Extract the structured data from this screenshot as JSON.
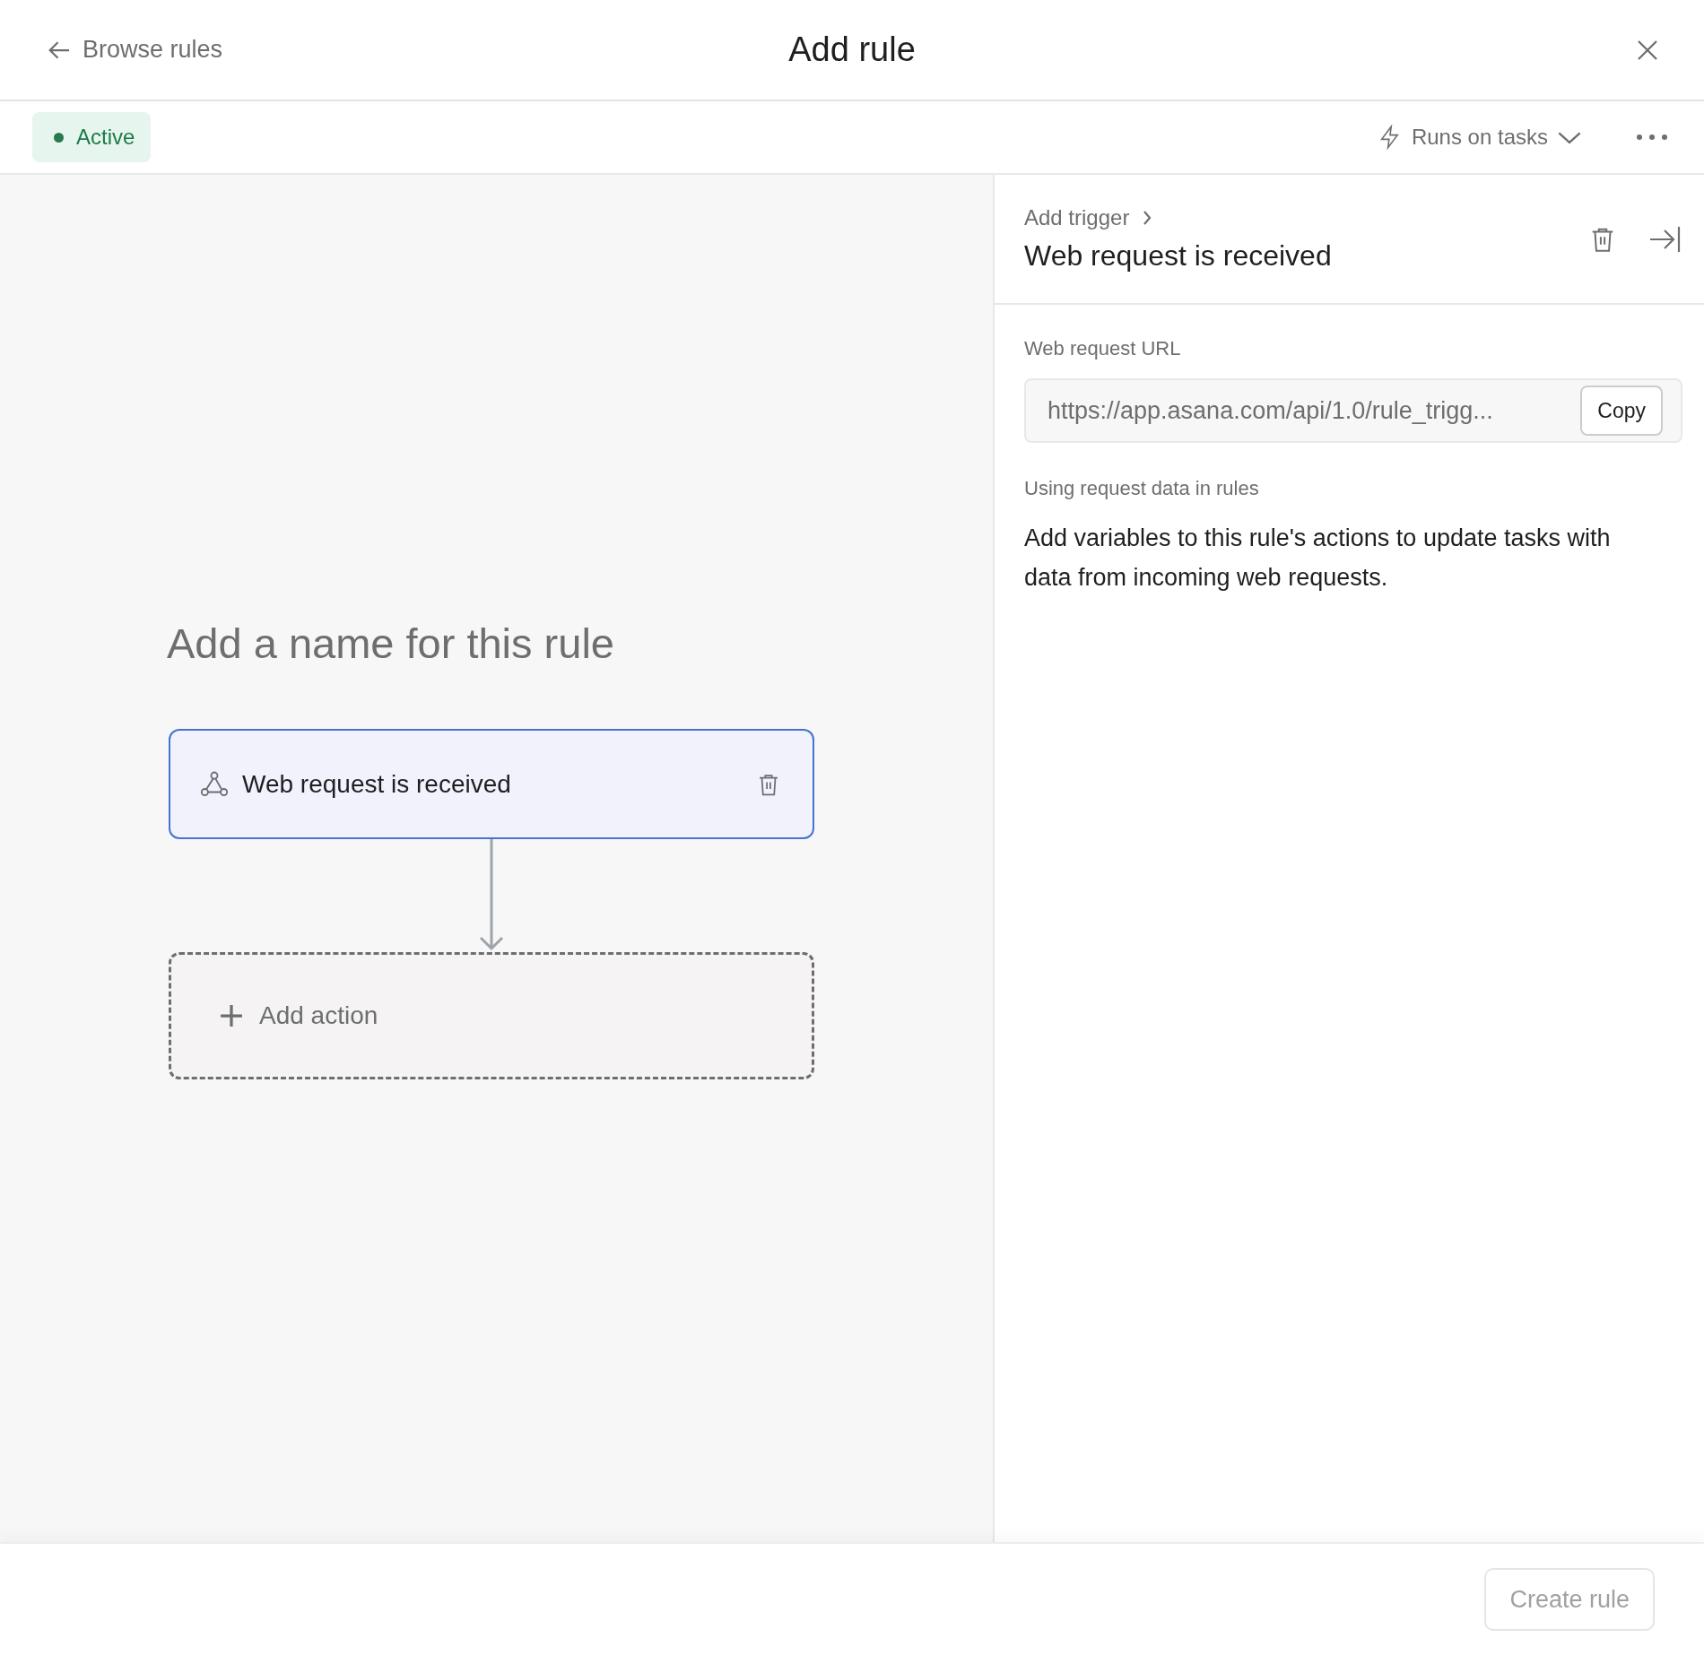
{
  "header": {
    "back_link": "Browse rules",
    "title": "Add rule"
  },
  "toolbar": {
    "status": {
      "label": "Active",
      "active": true
    },
    "runs_on": "Runs on tasks"
  },
  "canvas": {
    "rule_name_placeholder": "Add a name for this rule",
    "trigger": {
      "label": "Web request is received",
      "selected": true
    },
    "add_action": "Add action"
  },
  "panel": {
    "breadcrumb": "Add trigger",
    "title": "Web request is received",
    "url_label": "Web request URL",
    "url_value": "https://app.asana.com/api/1.0/rule_trigg...",
    "copy_button": "Copy",
    "section_title": "Using request data in rules",
    "description": "Add variables to this rule's actions to update tasks with data from incoming web requests."
  },
  "footer": {
    "create_button": {
      "label": "Create rule",
      "disabled": true
    }
  }
}
